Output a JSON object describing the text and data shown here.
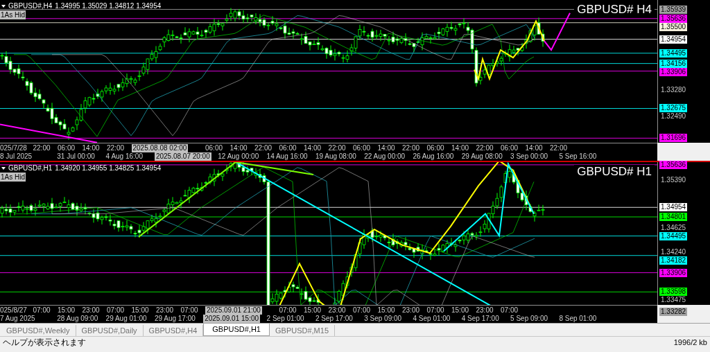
{
  "panes": [
    {
      "symbol": "GBPUSD#,H4",
      "ohlc": "1.34995 1.35029 1.34812 1.34954",
      "indicator_label": "1As Hid",
      "title": "GBPUSD# H4",
      "price_axis": [
        {
          "kind": "tag",
          "text": "1.35939",
          "color": "#a0a0a0"
        },
        {
          "kind": "tag",
          "text": "1.35636",
          "color": "#ff00ff"
        },
        {
          "kind": "tag",
          "text": "1.35500",
          "color": "#f5f0dc"
        },
        {
          "kind": "tag",
          "text": "1.34954",
          "color": "#ffffff"
        },
        {
          "kind": "tag",
          "text": "1.34495",
          "color": "#00ffff"
        },
        {
          "kind": "tag",
          "text": "1.34156",
          "color": "#00ffff"
        },
        {
          "kind": "tag",
          "text": "1.33906",
          "color": "#ff00ff"
        },
        {
          "kind": "plain",
          "text": "1.33280"
        },
        {
          "kind": "tag",
          "text": "1.32675",
          "color": "#00ffff"
        },
        {
          "kind": "plain",
          "text": "1.32490"
        },
        {
          "kind": "tag",
          "text": "1.31696",
          "color": "#ff00ff"
        }
      ],
      "time_row_1": [
        {
          "kind": "plain",
          "text": "025/7/28"
        },
        {
          "kind": "plain",
          "text": "22:00"
        },
        {
          "kind": "plain",
          "text": "06:00"
        },
        {
          "kind": "plain",
          "text": "14:00"
        },
        {
          "kind": "plain",
          "text": "22:00"
        },
        {
          "kind": "highlight",
          "text": "2025.08.08 02:00"
        },
        {
          "kind": "plain",
          "text": "06:00"
        },
        {
          "kind": "plain",
          "text": "14:00"
        },
        {
          "kind": "plain",
          "text": "22:00"
        },
        {
          "kind": "plain",
          "text": "06:00"
        },
        {
          "kind": "plain",
          "text": "14:00"
        },
        {
          "kind": "plain",
          "text": "22:00"
        },
        {
          "kind": "plain",
          "text": "06:00"
        },
        {
          "kind": "plain",
          "text": "14:00"
        },
        {
          "kind": "plain",
          "text": "22:00"
        },
        {
          "kind": "plain",
          "text": "06:00"
        },
        {
          "kind": "plain",
          "text": "14:00"
        },
        {
          "kind": "plain",
          "text": "22:00"
        },
        {
          "kind": "plain",
          "text": "06:00"
        },
        {
          "kind": "plain",
          "text": "14:00"
        },
        {
          "kind": "plain",
          "text": "22:00"
        }
      ],
      "time_row_2": [
        {
          "kind": "plain",
          "text": "8 Jul 2025"
        },
        {
          "kind": "plain",
          "text": "31 Jul 00:00"
        },
        {
          "kind": "plain",
          "text": "4 Aug 16:00"
        },
        {
          "kind": "highlight",
          "text": "2025.08.07 20:00"
        },
        {
          "kind": "plain",
          "text": "12 Aug 00:00"
        },
        {
          "kind": "plain",
          "text": "14 Aug 16:00"
        },
        {
          "kind": "plain",
          "text": "19 Aug 08:00"
        },
        {
          "kind": "plain",
          "text": "22 Aug 00:00"
        },
        {
          "kind": "plain",
          "text": "26 Aug 16:00"
        },
        {
          "kind": "plain",
          "text": "29 Aug 08:00"
        },
        {
          "kind": "plain",
          "text": "3 Sep 00:00"
        },
        {
          "kind": "plain",
          "text": "5 Sep 16:00"
        }
      ]
    },
    {
      "symbol": "GBPUSD#,H1",
      "ohlc": "1.34920 1.34955 1.34825 1.34954",
      "indicator_label": "1As Hid",
      "title": "GBPUSD# H1",
      "price_axis": [
        {
          "kind": "tag",
          "text": "1.35636",
          "color": "#ff00ff"
        },
        {
          "kind": "plain",
          "text": "1.35390"
        },
        {
          "kind": "tag",
          "text": "1.34954",
          "color": "#ffffff"
        },
        {
          "kind": "tag",
          "text": "1.34801",
          "color": "#00ff00"
        },
        {
          "kind": "plain",
          "text": "1.34625"
        },
        {
          "kind": "tag",
          "text": "1.34495",
          "color": "#00ffff"
        },
        {
          "kind": "plain",
          "text": "1.34240"
        },
        {
          "kind": "tag",
          "text": "1.34182",
          "color": "#00ffff"
        },
        {
          "kind": "tag",
          "text": "1.33906",
          "color": "#ff00ff"
        },
        {
          "kind": "tag",
          "text": "1.33598",
          "color": "#00ff00"
        },
        {
          "kind": "plain",
          "text": "1.33475"
        },
        {
          "kind": "tag",
          "text": "1.33282",
          "color": "#a0a0a0"
        }
      ],
      "time_row_1": [
        {
          "kind": "plain",
          "text": "025/8/27"
        },
        {
          "kind": "plain",
          "text": "07:00"
        },
        {
          "kind": "plain",
          "text": "15:00"
        },
        {
          "kind": "plain",
          "text": "23:00"
        },
        {
          "kind": "plain",
          "text": "07:00"
        },
        {
          "kind": "plain",
          "text": "15:00"
        },
        {
          "kind": "plain",
          "text": "23:00"
        },
        {
          "kind": "plain",
          "text": "07:00"
        },
        {
          "kind": "highlight",
          "text": "2025.09.01 21:00"
        },
        {
          "kind": "plain",
          "text": "07:00"
        },
        {
          "kind": "plain",
          "text": "15:00"
        },
        {
          "kind": "plain",
          "text": "23:00"
        },
        {
          "kind": "plain",
          "text": "07:00"
        },
        {
          "kind": "plain",
          "text": "15:00"
        },
        {
          "kind": "plain",
          "text": "23:00"
        },
        {
          "kind": "plain",
          "text": "07:00"
        },
        {
          "kind": "plain",
          "text": "15:00"
        },
        {
          "kind": "plain",
          "text": "23:00"
        },
        {
          "kind": "plain",
          "text": "07:00"
        }
      ],
      "time_row_2": [
        {
          "kind": "plain",
          "text": "7 Aug 2025"
        },
        {
          "kind": "plain",
          "text": "28 Aug 09:00"
        },
        {
          "kind": "plain",
          "text": "29 Aug 01:00"
        },
        {
          "kind": "plain",
          "text": "29 Aug 17:00"
        },
        {
          "kind": "highlight",
          "text": "2025.09.01 15:00"
        },
        {
          "kind": "plain",
          "text": "2 Sep 01:00"
        },
        {
          "kind": "plain",
          "text": "2 Sep 17:00"
        },
        {
          "kind": "plain",
          "text": "3 Sep 09:00"
        },
        {
          "kind": "plain",
          "text": "4 Sep 01:00"
        },
        {
          "kind": "plain",
          "text": "4 Sep 17:00"
        },
        {
          "kind": "plain",
          "text": "5 Sep 09:00"
        },
        {
          "kind": "plain",
          "text": "8 Sep 01:00"
        }
      ]
    }
  ],
  "tabs": [
    {
      "label": "GBPUSD#,Weekly",
      "selected": false
    },
    {
      "label": "GBPUSD#,Daily",
      "selected": false
    },
    {
      "label": "GBPUSD#,H4",
      "selected": false
    },
    {
      "label": "GBPUSD#,H1",
      "selected": true
    },
    {
      "label": "GBPUSD#,M15",
      "selected": false
    }
  ],
  "status_bar": {
    "help": "ヘルプが表示されます",
    "traffic": "1996/2 kb"
  }
}
